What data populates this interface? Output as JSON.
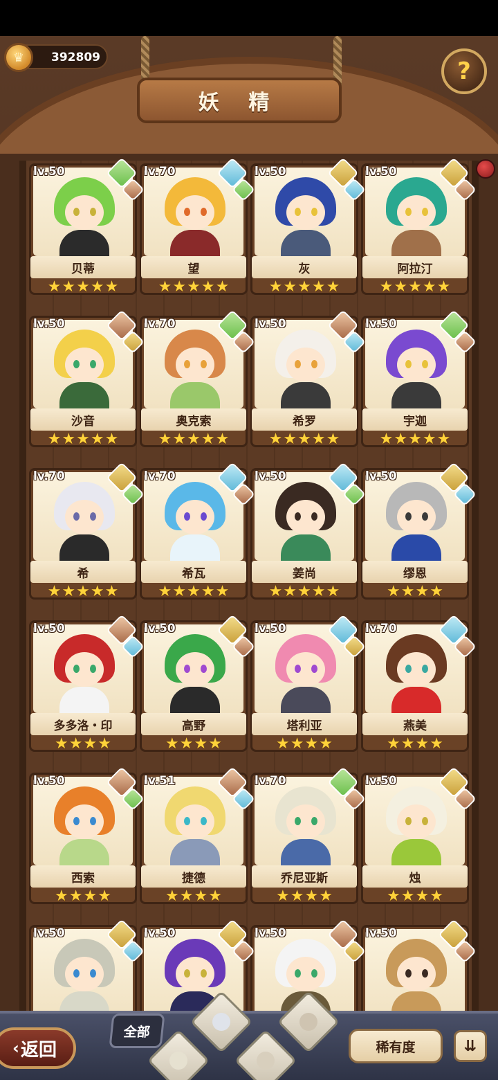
{
  "currency": {
    "icon": "crown-coin-icon",
    "value": "392809"
  },
  "header": {
    "title": "妖 精",
    "help_icon": "question-sprout-icon"
  },
  "cards": [
    {
      "name": "贝蒂",
      "level": "lv.50",
      "stars": 5,
      "element": "nature",
      "sub": "rock",
      "hair": "#7ccf4a",
      "eye": "#c8b23a",
      "body": "#2b2b2b"
    },
    {
      "name": "望",
      "level": "lv.70",
      "stars": 5,
      "element": "water",
      "sub": "nature",
      "hair": "#f3b93a",
      "eye": "#e06a2a",
      "body": "#8a2a2a"
    },
    {
      "name": "灰",
      "level": "lv.50",
      "stars": 5,
      "element": "earth",
      "sub": "water",
      "hair": "#2f4aa8",
      "eye": "#e8c23a",
      "body": "#4a5a7a"
    },
    {
      "name": "阿拉汀",
      "level": "lv.50",
      "stars": 5,
      "element": "earth",
      "sub": "rock",
      "hair": "#2aa890",
      "eye": "#e8c23a",
      "body": "#a0704a"
    },
    {
      "name": "沙音",
      "level": "lv.50",
      "stars": 5,
      "element": "rock",
      "sub": "earth",
      "hair": "#f3d04a",
      "eye": "#3aa86a",
      "body": "#3a6a3a"
    },
    {
      "name": "奥克索",
      "level": "lv.70",
      "stars": 5,
      "element": "nature",
      "sub": "rock",
      "hair": "#d8884a",
      "eye": "#e8a23a",
      "body": "#9ac86a"
    },
    {
      "name": "希罗",
      "level": "lv.50",
      "stars": 5,
      "element": "rock",
      "sub": "water",
      "hair": "#f4f0ea",
      "eye": "#e8a23a",
      "body": "#3a3a3a"
    },
    {
      "name": "宇迦",
      "level": "lv.50",
      "stars": 5,
      "element": "nature",
      "sub": "rock",
      "hair": "#7a4ad0",
      "eye": "#e8c23a",
      "body": "#3a3a3a"
    },
    {
      "name": "希",
      "level": "lv.70",
      "stars": 5,
      "element": "earth",
      "sub": "nature",
      "hair": "#e8e8f0",
      "eye": "#6a6aa8",
      "body": "#2a2a2a"
    },
    {
      "name": "希瓦",
      "level": "lv.70",
      "stars": 5,
      "element": "water",
      "sub": "rock",
      "hair": "#5ab8e8",
      "eye": "#6a4ad0",
      "body": "#e8f4fa"
    },
    {
      "name": "姜尚",
      "level": "lv.50",
      "stars": 5,
      "element": "water",
      "sub": "nature",
      "hair": "#3a2a22",
      "eye": "#3a2a22",
      "body": "#3a8a5a"
    },
    {
      "name": "缪恩",
      "level": "lv.50",
      "stars": 4,
      "element": "earth",
      "sub": "water",
      "hair": "#b8b8b8",
      "eye": "#3a3a3a",
      "body": "#2a4aa8"
    },
    {
      "name": "多多洛・印",
      "level": "lv.50",
      "stars": 4,
      "element": "rock",
      "sub": "water",
      "hair": "#c82a2a",
      "eye": "#3aa86a",
      "body": "#f4f4f4"
    },
    {
      "name": "高野",
      "level": "lv.50",
      "stars": 4,
      "element": "earth",
      "sub": "rock",
      "hair": "#3aa84a",
      "eye": "#a04ad0",
      "body": "#2a2a2a"
    },
    {
      "name": "塔利亚",
      "level": "lv.50",
      "stars": 4,
      "element": "water",
      "sub": "earth",
      "hair": "#f08ab0",
      "eye": "#a04ad0",
      "body": "#4a4a5a"
    },
    {
      "name": "燕美",
      "level": "lv.70",
      "stars": 4,
      "element": "water",
      "sub": "rock",
      "hair": "#6a3a22",
      "eye": "#3aa8a0",
      "body": "#d82a2a"
    },
    {
      "name": "西索",
      "level": "lv.50",
      "stars": 4,
      "element": "rock",
      "sub": "nature",
      "hair": "#e8802a",
      "eye": "#3a8ad0",
      "body": "#b8d88a"
    },
    {
      "name": "捷德",
      "level": "lv.51",
      "stars": 4,
      "element": "rock",
      "sub": "water",
      "hair": "#f0d870",
      "eye": "#3ab8c8",
      "body": "#8a9ab8"
    },
    {
      "name": "乔尼亚斯",
      "level": "lv.70",
      "stars": 4,
      "element": "nature",
      "sub": "rock",
      "hair": "#e8e4d0",
      "eye": "#3aa86a",
      "body": "#4a6aa8"
    },
    {
      "name": "烛",
      "level": "lv.50",
      "stars": 4,
      "element": "earth",
      "sub": "rock",
      "hair": "#f4f0e0",
      "eye": "#c8b23a",
      "body": "#9ac83a"
    },
    {
      "name": "",
      "level": "lv.50",
      "stars": 0,
      "element": "earth",
      "sub": "water",
      "hair": "#c8c8b8",
      "eye": "#3a8ad0",
      "body": "#d8d8c8"
    },
    {
      "name": "",
      "level": "lv.50",
      "stars": 0,
      "element": "earth",
      "sub": "rock",
      "hair": "#6a3ab8",
      "eye": "#c8b23a",
      "body": "#2a2a5a"
    },
    {
      "name": "",
      "level": "lv.50",
      "stars": 0,
      "element": "rock",
      "sub": "earth",
      "hair": "#f4f4f4",
      "eye": "#3aa86a",
      "body": "#6a5a3a"
    },
    {
      "name": "",
      "level": "lv.50",
      "stars": 0,
      "element": "earth",
      "sub": "rock",
      "hair": "#c89a5a",
      "eye": "#3a2a22",
      "body": "#c89a5a"
    }
  ],
  "bottom": {
    "back_label": "返回",
    "filter_all": "全部",
    "sort_label": "稀有度",
    "order_icon": "sort-order-icon"
  }
}
